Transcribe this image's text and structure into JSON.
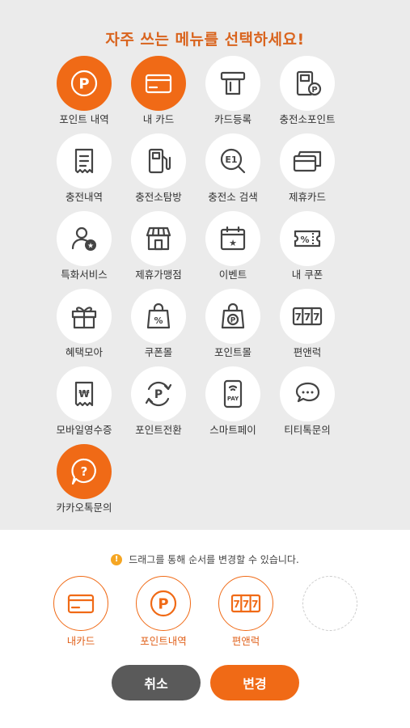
{
  "title": "자주 쓰는 메뉴를 선택하세요!",
  "accent_color": "#f06a16",
  "menu": [
    {
      "label": "포인트 내역",
      "icon": "point-p-icon",
      "active": true
    },
    {
      "label": "내 카드",
      "icon": "card-icon",
      "active": true
    },
    {
      "label": "카드등록",
      "icon": "card-register-icon",
      "active": false
    },
    {
      "label": "충전소포인트",
      "icon": "station-point-icon",
      "active": false
    },
    {
      "label": "충전내역",
      "icon": "receipt-icon",
      "active": false
    },
    {
      "label": "충전소탐방",
      "icon": "fuel-pump-icon",
      "active": false
    },
    {
      "label": "충전소 검색",
      "icon": "e1-search-icon",
      "active": false
    },
    {
      "label": "제휴카드",
      "icon": "cards-icon",
      "active": false
    },
    {
      "label": "특화서비스",
      "icon": "user-star-icon",
      "active": false
    },
    {
      "label": "제휴가맹점",
      "icon": "store-icon",
      "active": false
    },
    {
      "label": "이벤트",
      "icon": "calendar-star-icon",
      "active": false
    },
    {
      "label": "내 쿠폰",
      "icon": "coupon-icon",
      "active": false
    },
    {
      "label": "혜택모아",
      "icon": "gift-icon",
      "active": false
    },
    {
      "label": "쿠폰몰",
      "icon": "bag-percent-icon",
      "active": false
    },
    {
      "label": "포인트몰",
      "icon": "bag-p-icon",
      "active": false
    },
    {
      "label": "편앤럭",
      "icon": "slot-777-icon",
      "active": false
    },
    {
      "label": "모바일영수증",
      "icon": "mobile-receipt-icon",
      "active": false
    },
    {
      "label": "포인트전환",
      "icon": "point-exchange-icon",
      "active": false
    },
    {
      "label": "스마트페이",
      "icon": "smart-pay-icon",
      "active": false
    },
    {
      "label": "티티톡문의",
      "icon": "chat-bubble-icon",
      "active": false
    },
    {
      "label": "카카오톡문의",
      "icon": "kakao-question-icon",
      "active": true
    }
  ],
  "hint": {
    "icon_text": "!",
    "text": "드래그를 통해 순서를 변경할 수 있습니다."
  },
  "favorites": [
    {
      "label": "내카드",
      "icon": "card-icon"
    },
    {
      "label": "포인트내역",
      "icon": "point-p-icon"
    },
    {
      "label": "편앤럭",
      "icon": "slot-777-icon"
    }
  ],
  "buttons": {
    "cancel": "취소",
    "confirm": "변경"
  }
}
